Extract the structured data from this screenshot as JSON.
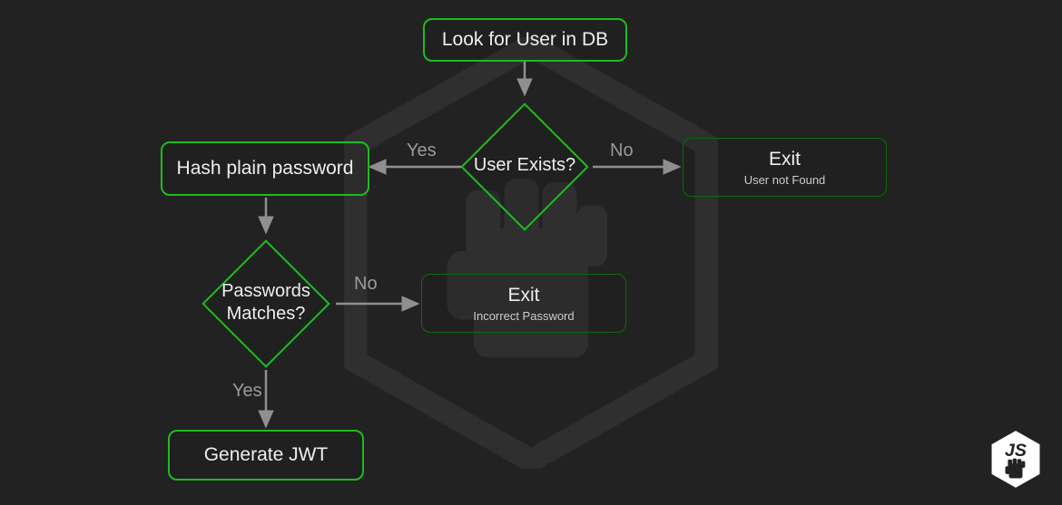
{
  "diagram": {
    "nodes": {
      "look_db": "Look for User in DB",
      "user_exists": "User Exists?",
      "hash_pw": "Hash plain password",
      "exit_notfound_title": "Exit",
      "exit_notfound_sub": "User not Found",
      "pw_matches": "Passwords Matches?",
      "exit_wrongpw_title": "Exit",
      "exit_wrongpw_sub": "Incorrect Password",
      "gen_jwt": "Generate JWT"
    },
    "labels": {
      "yes1": "Yes",
      "no1": "No",
      "no2": "No",
      "yes2": "Yes"
    },
    "colors": {
      "bg": "#222222",
      "stroke_bright": "#1fbb1f",
      "stroke_dim": "#0e6a0e",
      "arrow": "#8f8f8f",
      "text": "#eeeeee"
    }
  }
}
